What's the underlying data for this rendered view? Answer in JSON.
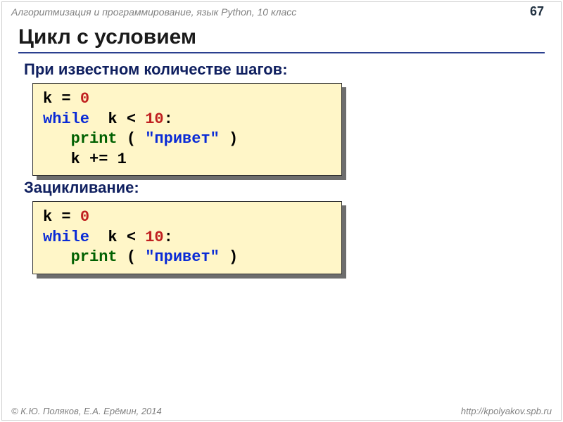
{
  "header": {
    "course": "Алгоритмизация и программирование, язык Python, 10 класс",
    "page": "67"
  },
  "title": "Цикл с условием",
  "sections": {
    "known_steps": {
      "heading": "При известном количестве шагов:",
      "code": {
        "l1_lhs": "k = ",
        "l1_num": "0",
        "l2_kw": "while",
        "l2_mid": "  k < ",
        "l2_num": "10",
        "l2_colon": ":",
        "l3_indent": "   ",
        "l3_fn": "print",
        "l3_open": " ( ",
        "l3_str": "\"привет\"",
        "l3_close": " )",
        "l4": "   k += 1"
      }
    },
    "infinite": {
      "heading": "Зацикливание:",
      "code": {
        "l1_lhs": "k = ",
        "l1_num": "0",
        "l2_kw": "while",
        "l2_mid": "  k < ",
        "l2_num": "10",
        "l2_colon": ":",
        "l3_indent": "   ",
        "l3_fn": "print",
        "l3_open": " ( ",
        "l3_str": "\"привет\"",
        "l3_close": " )"
      }
    }
  },
  "footer": {
    "authors": "© К.Ю. Поляков, Е.А. Ерёмин, 2014",
    "url": "http://kpolyakov.spb.ru"
  }
}
